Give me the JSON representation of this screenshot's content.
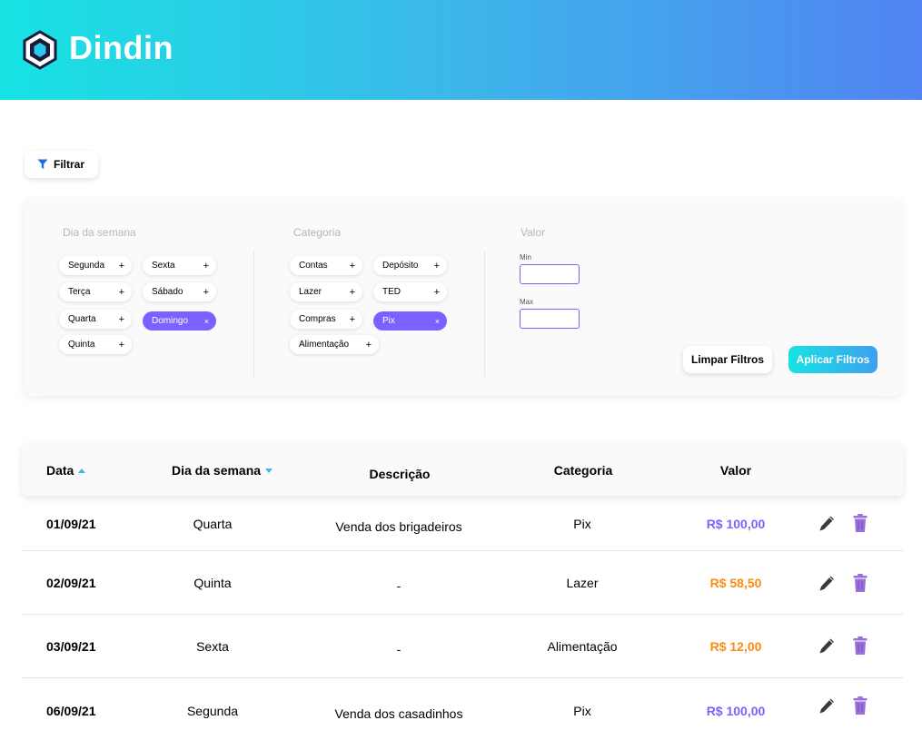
{
  "app": {
    "brand": "Dindin"
  },
  "toolbar": {
    "filter_label": "Filtrar"
  },
  "filters": {
    "weekday": {
      "title": "Dia da semana",
      "chips": [
        {
          "label": "Segunda",
          "active": false,
          "symbol": "+"
        },
        {
          "label": "Sexta",
          "active": false,
          "symbol": "+"
        },
        {
          "label": "Terça",
          "active": false,
          "symbol": "+"
        },
        {
          "label": "Sábado",
          "active": false,
          "symbol": "+"
        },
        {
          "label": "Quarta",
          "active": false,
          "symbol": "+"
        },
        {
          "label": "Domingo",
          "active": true,
          "symbol": "×"
        },
        {
          "label": "Quinta",
          "active": false,
          "symbol": "+"
        }
      ]
    },
    "category": {
      "title": "Categoria",
      "chips": [
        {
          "label": "Contas",
          "active": false,
          "symbol": "+"
        },
        {
          "label": "Depósito",
          "active": false,
          "symbol": "+"
        },
        {
          "label": "Lazer",
          "active": false,
          "symbol": "+"
        },
        {
          "label": "TED",
          "active": false,
          "symbol": "+"
        },
        {
          "label": "Compras",
          "active": false,
          "symbol": "+"
        },
        {
          "label": "Pix",
          "active": true,
          "symbol": "×"
        },
        {
          "label": "Alimentação",
          "active": false,
          "symbol": "+"
        }
      ]
    },
    "value": {
      "title": "Valor",
      "min_label": "Min",
      "max_label": "Max",
      "min_value": "",
      "max_value": ""
    },
    "clear_label": "Limpar Filtros",
    "apply_label": "Aplicar Filtros"
  },
  "table": {
    "headers": {
      "date": "Data",
      "weekday": "Dia da semana",
      "description": "Descrição",
      "category": "Categoria",
      "value": "Valor"
    },
    "sort": {
      "date": "ascending",
      "weekday": "descending"
    },
    "rows": [
      {
        "date": "01/09/21",
        "weekday": "Quarta",
        "description": "Venda dos brigadeiros",
        "category": "Pix",
        "value": "R$ 100,00",
        "value_type": "income"
      },
      {
        "date": "02/09/21",
        "weekday": "Quinta",
        "description": "-",
        "category": "Lazer",
        "value": "R$ 58,50",
        "value_type": "expense"
      },
      {
        "date": "03/09/21",
        "weekday": "Sexta",
        "description": "-",
        "category": "Alimentação",
        "value": "R$ 12,00",
        "value_type": "expense"
      },
      {
        "date": "06/09/21",
        "weekday": "Segunda",
        "description": "Venda dos casadinhos",
        "category": "Pix",
        "value": "R$ 100,00",
        "value_type": "income"
      }
    ],
    "row_actions": [
      "pencil-icon",
      "trash-icon"
    ]
  },
  "colors": {
    "accent_purple": "#7b61ff",
    "income": "#7b61ff",
    "expense": "#fa8c10",
    "header_gradient_start": "#17e3e3",
    "header_gradient_end": "#5184f2",
    "trash": "#9b6fd9",
    "pencil": "#3a3a3a"
  }
}
